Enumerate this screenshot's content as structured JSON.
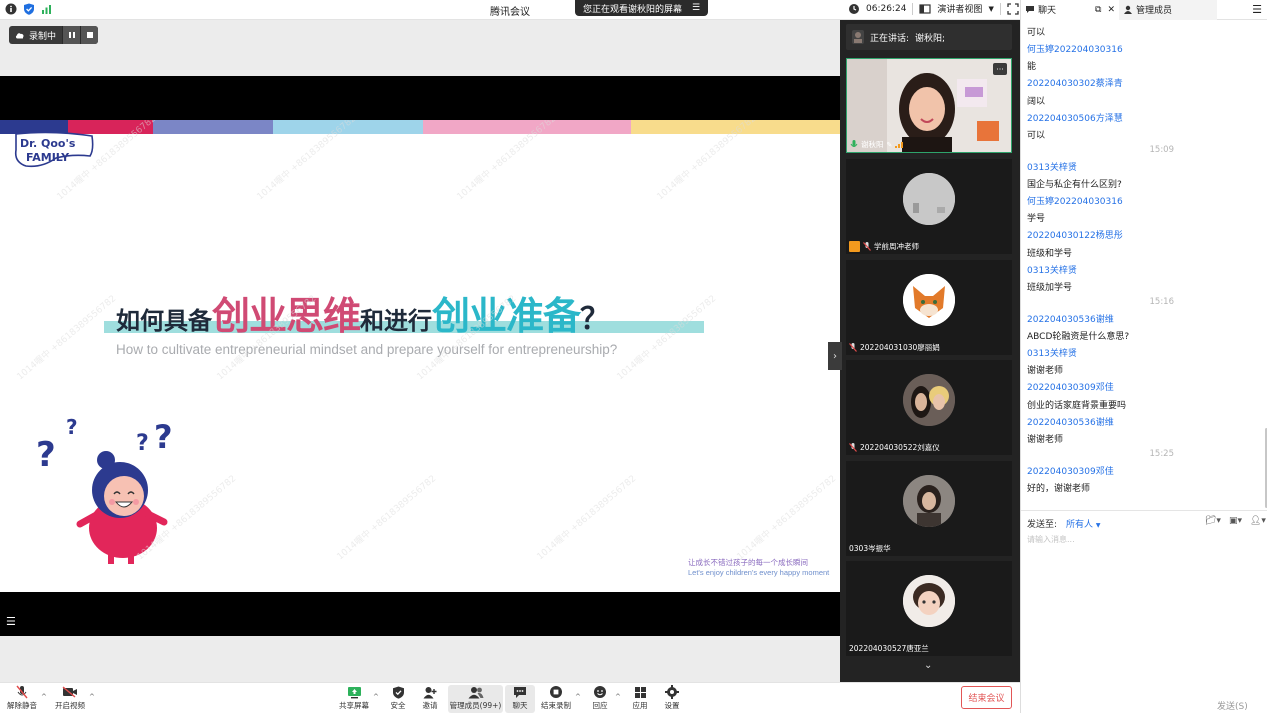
{
  "titlebar": {
    "app_title": "腾讯会议",
    "sharing_banner": "您正在观看谢秋阳的屏幕",
    "meeting_time": "06:26:24",
    "view_mode": "演讲者视图"
  },
  "recording": {
    "status_label": "录制中"
  },
  "slide": {
    "logo_text_1": "Dr. Qoo's",
    "logo_text_2": "FAMILY",
    "title_part_1": "如何具备",
    "title_part_2": "创业思维",
    "title_part_3": "和进行",
    "title_part_4": "创业准备",
    "title_part_5": "？",
    "subtitle": "How to cultivate entrepreneurial mindset and prepare yourself for entrepreneurship?",
    "slogan_cn": "让成长不错过孩子的每一个成长瞬间",
    "slogan_en": "Let's enjoy children's every happy moment",
    "colors": {
      "strip": [
        "#2c3a8f",
        "#d8245a",
        "#7b86c6",
        "#9ed4ea",
        "#f1a7c6",
        "#f8dc8c"
      ],
      "title_pink": "#d04a74",
      "title_teal": "#2bb7c9"
    }
  },
  "participants": {
    "speaking_label": "正在讲话:",
    "speaking_name": "谢秋阳;",
    "tiles": [
      {
        "name": "谢秋阳"
      },
      {
        "name": "学前周冲老师"
      },
      {
        "name": "202204031030廖丽娟"
      },
      {
        "name": "202204030522刘嘉仪"
      },
      {
        "name": "0303岑振华"
      },
      {
        "name": "202204030527唐亚兰"
      }
    ]
  },
  "chat": {
    "tab_chat": "聊天",
    "tab_members": "管理成员",
    "messages": [
      {
        "kind": "body",
        "text": "可以"
      },
      {
        "kind": "sender",
        "text": "何玉婷202204030316"
      },
      {
        "kind": "body",
        "text": "能"
      },
      {
        "kind": "sender",
        "text": "202204030302蔡泽青"
      },
      {
        "kind": "body",
        "text": "阔以"
      },
      {
        "kind": "sender",
        "text": "202204030506方泽慧"
      },
      {
        "kind": "body",
        "text": "可以"
      },
      {
        "kind": "time",
        "text": "15:09"
      },
      {
        "kind": "sender",
        "text": "0313关梓贤"
      },
      {
        "kind": "body",
        "text": "国企与私企有什么区别?"
      },
      {
        "kind": "sender",
        "text": "何玉婷202204030316"
      },
      {
        "kind": "body",
        "text": "学号"
      },
      {
        "kind": "sender",
        "text": "202204030122杨思彤"
      },
      {
        "kind": "body",
        "text": "班级和学号"
      },
      {
        "kind": "sender",
        "text": "0313关梓贤"
      },
      {
        "kind": "body",
        "text": "班级加学号"
      },
      {
        "kind": "time",
        "text": "15:16"
      },
      {
        "kind": "sender",
        "text": "202204030536谢维"
      },
      {
        "kind": "body",
        "text": "ABCD轮融资是什么意思?"
      },
      {
        "kind": "sender",
        "text": "0313关梓贤"
      },
      {
        "kind": "body",
        "text": "谢谢老师"
      },
      {
        "kind": "sender",
        "text": "202204030309邓佳"
      },
      {
        "kind": "body",
        "text": "创业的话家庭背景重要吗"
      },
      {
        "kind": "sender",
        "text": "202204030536谢维"
      },
      {
        "kind": "body",
        "text": "谢谢老师"
      },
      {
        "kind": "time",
        "text": "15:25"
      },
      {
        "kind": "sender",
        "text": "202204030309邓佳"
      },
      {
        "kind": "body",
        "text": "好的，谢谢老师"
      }
    ],
    "send_to_label": "发送至:",
    "send_to_target": "所有人",
    "input_placeholder": "请输入消息...",
    "send_button": "发送(S)"
  },
  "toolbar": {
    "unmute": "解除静音",
    "start_video": "开启视频",
    "share_screen": "共享屏幕",
    "security": "安全",
    "invite": "邀请",
    "manage_members": "管理成员(99+)",
    "chat": "聊天",
    "end_recording": "结束录制",
    "reactions": "回应",
    "apps": "应用",
    "settings": "设置",
    "end_meeting": "结束会议"
  }
}
